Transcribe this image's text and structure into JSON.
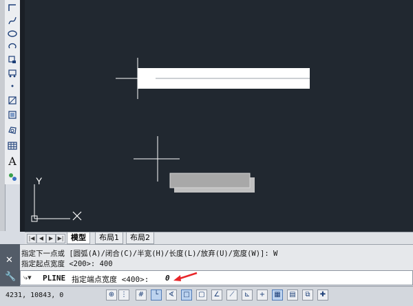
{
  "toolbar": {
    "icons": [
      "polyline-icon",
      "spline-icon",
      "ellipse-icon",
      "ellipse-arc-icon",
      "insert-block-icon",
      "make-block-icon",
      "point-icon",
      "hatch-icon",
      "gradient-icon",
      "region-icon",
      "table-icon",
      "text-icon",
      "add-selected-icon"
    ],
    "text_glyph": "A"
  },
  "canvas": {
    "y_axis_label": "Y",
    "accent": "#ffffff"
  },
  "tabs": {
    "items": [
      {
        "label": "模型",
        "active": true
      },
      {
        "label": "布局1",
        "active": false
      },
      {
        "label": "布局2",
        "active": false
      }
    ]
  },
  "command": {
    "history_line_1": "指定下一点或 [圆弧(A)/闭合(C)/半宽(H)/长度(L)/放弃(U)/宽度(W)]: W",
    "history_line_2": "指定起点宽度 <200>: 400",
    "prompt_name": "PLINE",
    "prompt_text": "指定端点宽度 <400>:",
    "input_value": "0",
    "arrow_color": "#e8262a"
  },
  "status": {
    "coordinates": "4231, 10843, 0"
  }
}
